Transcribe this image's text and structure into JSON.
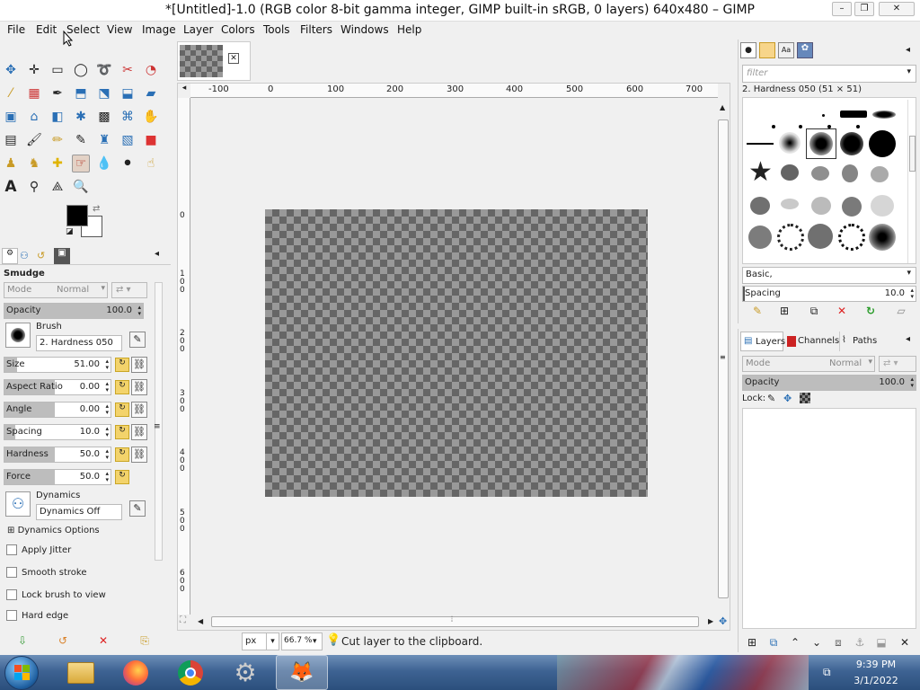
{
  "window": {
    "title": "*[Untitled]-1.0 (RGB color 8-bit gamma integer, GIMP built-in sRGB, 0 layers) 640x480 – GIMP",
    "min": "–",
    "max": "❐",
    "close": "✕"
  },
  "menu": [
    "File",
    "Edit",
    "Select",
    "View",
    "Image",
    "Layer",
    "Colors",
    "Tools",
    "Filters",
    "Windows",
    "Help"
  ],
  "tool_options": {
    "tool_name": "Smudge",
    "mode_label": "Mode",
    "mode_value": "Normal",
    "opacity": {
      "label": "Opacity",
      "value": "100.0",
      "fraction": 1.0
    },
    "brush_label": "Brush",
    "brush_value": "2. Hardness 050",
    "size": {
      "label": "Size",
      "value": "51.00",
      "fraction": 0.1
    },
    "aspect": {
      "label": "Aspect Ratio",
      "value": "0.00",
      "fraction": 0.5
    },
    "angle": {
      "label": "Angle",
      "value": "0.00",
      "fraction": 0.5
    },
    "spacing": {
      "label": "Spacing",
      "value": "10.0",
      "fraction": 0.1
    },
    "hardness": {
      "label": "Hardness",
      "value": "50.0",
      "fraction": 0.5
    },
    "force": {
      "label": "Force",
      "value": "50.0",
      "fraction": 0.5
    },
    "dynamics_label": "Dynamics",
    "dynamics_value": "Dynamics Off",
    "dynamics_options": "Dynamics Options",
    "apply_jitter": "Apply Jitter",
    "smooth_stroke": "Smooth stroke",
    "lock_brush": "Lock brush to view",
    "hard_edge": "Hard edge"
  },
  "ruler": {
    "h_ticks": [
      "-100",
      "0",
      "100",
      "200",
      "300",
      "400",
      "500",
      "600",
      "700"
    ],
    "v_ticks": [
      "0",
      "100",
      "200",
      "300",
      "400",
      "500",
      "600"
    ]
  },
  "statusbar": {
    "unit": "px",
    "zoom": "66.7 %",
    "message": "Cut layer to the clipboard."
  },
  "brushes": {
    "filter_placeholder": "filter",
    "selected": "2. Hardness 050 (51 × 51)",
    "preset": "Basic,",
    "spacing_label": "Spacing",
    "spacing_value": "10.0"
  },
  "layers": {
    "tabs": [
      "Layers",
      "Channels",
      "Paths"
    ],
    "mode_label": "Mode",
    "mode_value": "Normal",
    "opacity_label": "Opacity",
    "opacity_value": "100.0",
    "lock_label": "Lock:"
  },
  "taskbar": {
    "time": "9:39 PM",
    "date": "3/1/2022"
  }
}
